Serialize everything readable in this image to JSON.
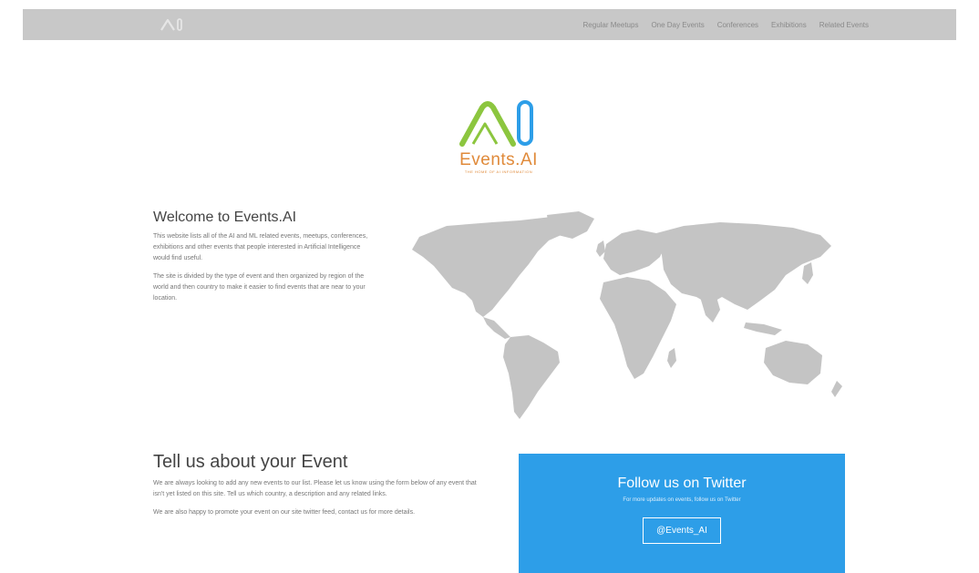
{
  "nav": {
    "logo": "AI",
    "items": [
      "Regular Meetups",
      "One Day Events",
      "Conferences",
      "Exhibitions",
      "Related Events"
    ]
  },
  "logo": {
    "text": "Events.AI",
    "tagline": "THE HOME OF AI INFORMATION",
    "colors": {
      "green": "#8cc63f",
      "blue": "#2d9ee8",
      "orange": "#e08a3a"
    }
  },
  "welcome": {
    "title": "Welcome to Events.AI",
    "p1": "This website lists all of the AI and ML related events, meetups, conferences, exhibitions and other events that people interested in Artificial Intelligence would find useful.",
    "p2": "The site is divided by the type of event and then organized by region of the world and then country to make it easier to find events that are near to your location."
  },
  "tell": {
    "title": "Tell us about your Event",
    "p1": "We are always looking to add any new events to our list. Please let us know using the form below of any event that isn't yet listed on this site. Tell us which country, a description and any related links.",
    "p2": "We are also happy to promote your event on our site twitter feed, contact us for more details."
  },
  "twitter": {
    "title": "Follow us on Twitter",
    "subtitle": "For more updates on events, follow us on Twitter",
    "handle": "@Events_AI",
    "color": "#2d9ee8"
  }
}
